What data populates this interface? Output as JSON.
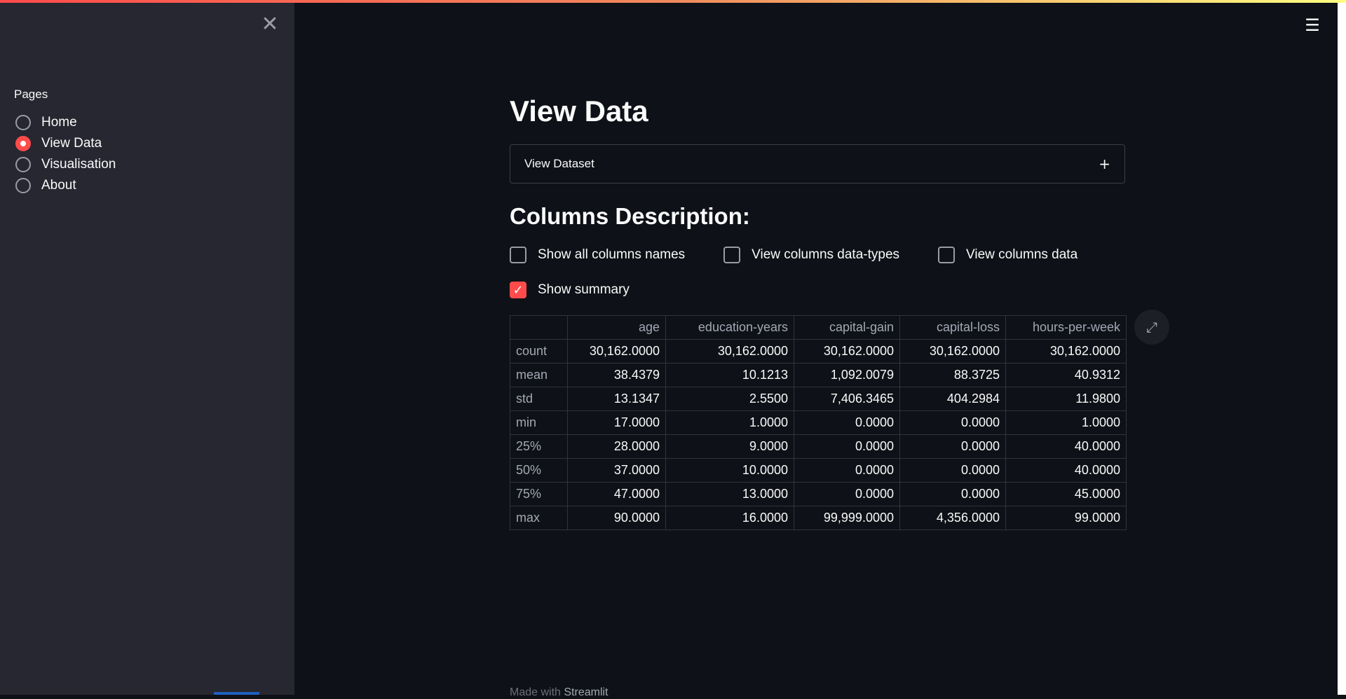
{
  "sidebar": {
    "pages_label": "Pages",
    "items": [
      {
        "label": "Home",
        "selected": false
      },
      {
        "label": "View Data",
        "selected": true
      },
      {
        "label": "Visualisation",
        "selected": false
      },
      {
        "label": "About",
        "selected": false
      }
    ],
    "close_icon": "close-icon"
  },
  "header": {
    "menu_icon": "hamburger-menu-icon"
  },
  "main": {
    "title": "View Data",
    "expander_label": "View Dataset",
    "section_title": "Columns Description:",
    "checkboxes": [
      {
        "label": "Show all columns names",
        "checked": false
      },
      {
        "label": "View columns data-types",
        "checked": false
      },
      {
        "label": "View columns data",
        "checked": false
      },
      {
        "label": "Show summary",
        "checked": true
      }
    ],
    "table": {
      "columns": [
        "",
        "age",
        "education-years",
        "capital-gain",
        "capital-loss",
        "hours-per-week"
      ],
      "rows": [
        [
          "count",
          "30,162.0000",
          "30,162.0000",
          "30,162.0000",
          "30,162.0000",
          "30,162.0000"
        ],
        [
          "mean",
          "38.4379",
          "10.1213",
          "1,092.0079",
          "88.3725",
          "40.9312"
        ],
        [
          "std",
          "13.1347",
          "2.5500",
          "7,406.3465",
          "404.2984",
          "11.9800"
        ],
        [
          "min",
          "17.0000",
          "1.0000",
          "0.0000",
          "0.0000",
          "1.0000"
        ],
        [
          "25%",
          "28.0000",
          "9.0000",
          "0.0000",
          "0.0000",
          "40.0000"
        ],
        [
          "50%",
          "37.0000",
          "10.0000",
          "0.0000",
          "0.0000",
          "40.0000"
        ],
        [
          "75%",
          "47.0000",
          "13.0000",
          "0.0000",
          "0.0000",
          "45.0000"
        ],
        [
          "max",
          "90.0000",
          "16.0000",
          "99,999.0000",
          "4,356.0000",
          "99.0000"
        ]
      ]
    }
  },
  "footer": {
    "prefix": "Made with ",
    "link": "Streamlit"
  },
  "colors": {
    "accent": "#ff4b4b",
    "background": "#0e1117",
    "sidebar": "#262730"
  }
}
